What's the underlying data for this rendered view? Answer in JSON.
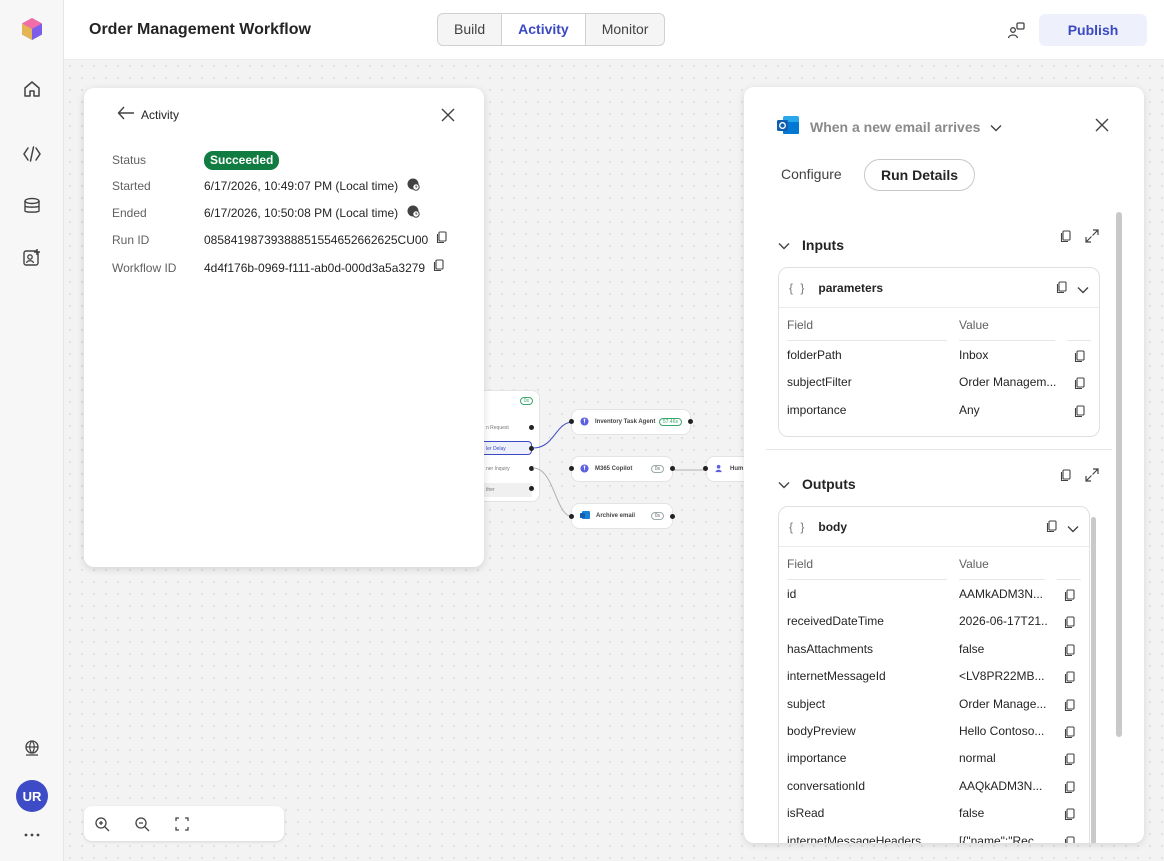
{
  "app": {
    "title": "Order Management Workflow",
    "publish_label": "Publish",
    "tabs": [
      "Build",
      "Activity",
      "Monitor"
    ],
    "active_tab": "Activity",
    "avatar_initials": "UR",
    "accent_color": "#3b49c3"
  },
  "rail": {
    "icons": [
      "app-logo-icon",
      "home-icon",
      "code-icon",
      "database-icon",
      "add-agent-icon",
      "globe-icon",
      "more-icon"
    ]
  },
  "canvas": {
    "nodes": [
      {
        "label": "Inventory Task Agent",
        "status": "57.46s"
      },
      {
        "label": "M365 Copilot",
        "status": "0s"
      },
      {
        "label": "Hum",
        "status": ""
      },
      {
        "label": "Archive email",
        "status": "0s"
      }
    ],
    "switch_status": "0s",
    "switch_cases": [
      "n Request",
      "ler Delay",
      "ner Inquiry",
      "ther"
    ]
  },
  "activity": {
    "back_label": "Activity",
    "fields": [
      {
        "label": "Status",
        "value": "Succeeded"
      },
      {
        "label": "Started",
        "value": "6/17/2026, 10:49:07 PM (Local time)"
      },
      {
        "label": "Ended",
        "value": "6/17/2026, 10:50:08 PM (Local time)"
      },
      {
        "label": "Run ID",
        "value": "08584198739388851554652662625CU00"
      },
      {
        "label": "Workflow ID",
        "value": "4d4f176b-0969-f111-ab0d-000d3a5a3279"
      }
    ],
    "status_color": "#107c41"
  },
  "panel": {
    "trigger_title": "When a new email arrives",
    "tabs": [
      "Configure",
      "Run Details"
    ],
    "active_tab": "Run Details",
    "inputs": {
      "heading": "Inputs",
      "box_title": "parameters",
      "col_field": "Field",
      "col_value": "Value",
      "rows": [
        {
          "field": "folderPath",
          "value": "Inbox"
        },
        {
          "field": "subjectFilter",
          "value": "Order Managem..."
        },
        {
          "field": "importance",
          "value": "Any"
        }
      ]
    },
    "outputs": {
      "heading": "Outputs",
      "box_title": "body",
      "col_field": "Field",
      "col_value": "Value",
      "rows": [
        {
          "field": "id",
          "value": "AAMkADM3N..."
        },
        {
          "field": "receivedDateTime",
          "value": "2026-06-17T21..."
        },
        {
          "field": "hasAttachments",
          "value": "false"
        },
        {
          "field": "internetMessageId",
          "value": "<LV8PR22MB..."
        },
        {
          "field": "subject",
          "value": "Order Manage..."
        },
        {
          "field": "bodyPreview",
          "value": "Hello Contoso..."
        },
        {
          "field": "importance",
          "value": "normal"
        },
        {
          "field": "conversationId",
          "value": "AAQkADM3N..."
        },
        {
          "field": "isRead",
          "value": "false"
        },
        {
          "field": "internetMessageHeaders",
          "value": "[{\"name\":\"Rec..."
        }
      ]
    }
  }
}
